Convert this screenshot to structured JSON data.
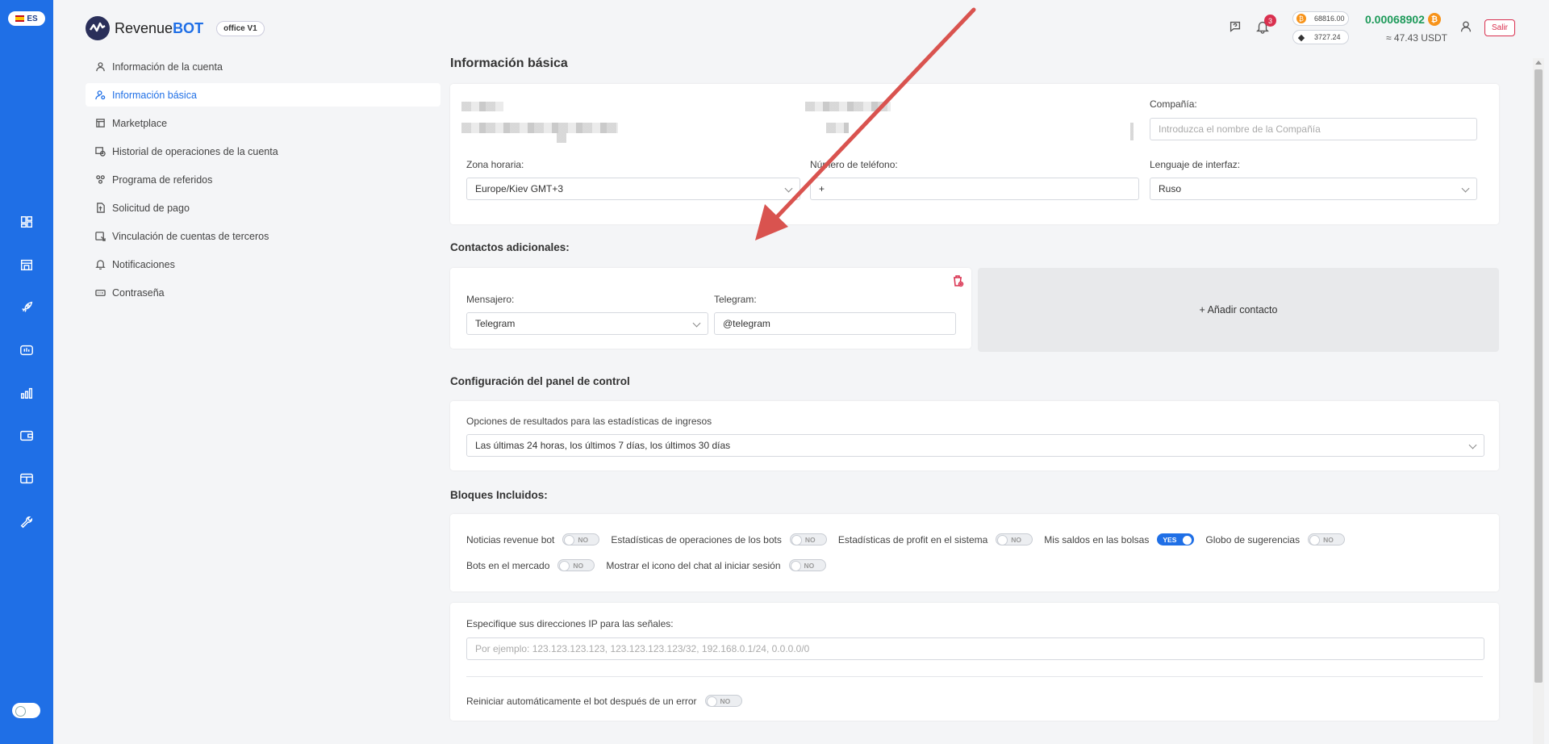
{
  "lang": {
    "code": "ES"
  },
  "header": {
    "logo_text_a": "Revenue",
    "logo_text_b": "BOT",
    "office_badge": "office V1",
    "notifications_count": "3",
    "btc_price": "68816.00",
    "eth_price": "3727.24",
    "balance_btc": "0.00068902",
    "balance_usdt": "≈ 47.43 USDT",
    "exit_label": "Salir"
  },
  "menu": {
    "items": [
      {
        "label": "Información de la cuenta",
        "icon": "user-icon"
      },
      {
        "label": "Información básica",
        "icon": "user-gear-icon"
      },
      {
        "label": "Marketplace",
        "icon": "store-icon"
      },
      {
        "label": "Historial de operaciones de la cuenta",
        "icon": "history-icon"
      },
      {
        "label": "Programa de referidos",
        "icon": "referral-icon"
      },
      {
        "label": "Solicitud de pago",
        "icon": "payment-icon"
      },
      {
        "label": "Vinculación de cuentas de terceros",
        "icon": "link-icon"
      },
      {
        "label": "Notificaciones",
        "icon": "bell-icon"
      },
      {
        "label": "Contraseña",
        "icon": "password-icon"
      }
    ]
  },
  "basic_info": {
    "title": "Información básica",
    "company_label": "Compañía:",
    "company_placeholder": "Introduzca el nombre de la Compañía",
    "timezone_label": "Zona horaria:",
    "timezone_value": "Europe/Kiev GMT+3",
    "phone_label": "Número de teléfono:",
    "phone_value": "+",
    "interface_lang_label": "Lenguaje de interfaz:",
    "interface_lang_value": "Ruso"
  },
  "contacts": {
    "title": "Contactos adicionales:",
    "messenger_label": "Mensajero:",
    "messenger_value": "Telegram",
    "telegram_label": "Telegram:",
    "telegram_value": "@telegram",
    "add_label": "+ Añadir contacto"
  },
  "dashboard": {
    "title": "Configuración del panel de control",
    "stats_label": "Opciones de resultados para las estadísticas de ingresos",
    "stats_value": "Las últimas 24 horas, los últimos 7 días, los últimos 30 días"
  },
  "blocks": {
    "title": "Bloques Incluidos:",
    "items": [
      {
        "label": "Noticias revenue bot",
        "state": "NO"
      },
      {
        "label": "Estadísticas de operaciones de los bots",
        "state": "NO"
      },
      {
        "label": "Estadísticas de profit en el sistema",
        "state": "NO"
      },
      {
        "label": "Mis saldos en las bolsas",
        "state": "YES"
      },
      {
        "label": "Globo de sugerencias",
        "state": "NO"
      },
      {
        "label": "Bots en el mercado",
        "state": "NO"
      },
      {
        "label": "Mostrar el icono del chat al iniciar sesión",
        "state": "NO"
      }
    ]
  },
  "signals": {
    "ip_label": "Especifique sus direcciones IP para las señales:",
    "ip_placeholder": "Por ejemplo: 123.123.123.123, 123.123.123.123/32, 192.168.0.1/24, 0.0.0.0/0",
    "restart_label": "Reiniciar automáticamente el bot después de un error",
    "restart_state": "NO"
  },
  "colors": {
    "primary": "#1f6fe6",
    "danger": "#d9304f",
    "balance": "#1e9a5a",
    "annotation_arrow": "#d9534f"
  }
}
